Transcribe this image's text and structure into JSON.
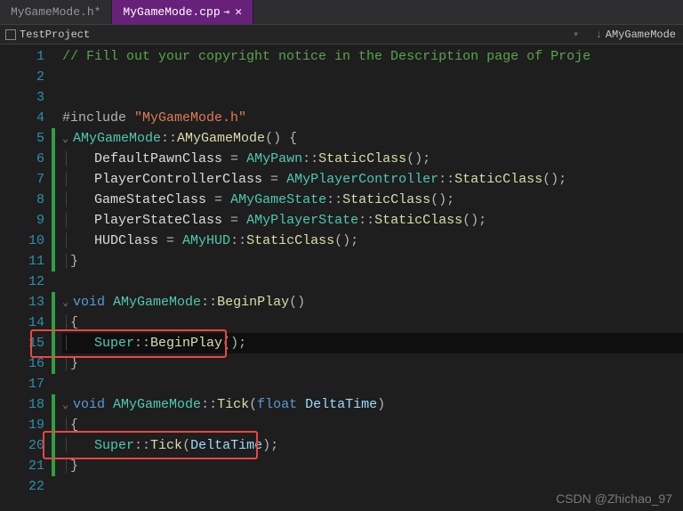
{
  "tabs": {
    "inactive_label": "MyGameMode.h*",
    "active_label": "MyGameMode.cpp",
    "pin_glyph": "⊸",
    "close_glyph": "✕"
  },
  "breadcrumb": {
    "project": "TestProject",
    "scope": "AMyGameMode",
    "arrow_down": "↓"
  },
  "lines": {
    "l1": "// Fill out your copyright notice in the Description page of Proje",
    "include_kw": "#include",
    "include_str": "\"MyGameMode.h\"",
    "class_a": "AMyGameMode",
    "dbl_colon": "::",
    "ctor_open": "() {",
    "defpawn": "DefaultPawnClass",
    "eq": " = ",
    "amypawn": "AMyPawn",
    "staticclass": "StaticClass",
    "callend": "();",
    "playerctrl": "PlayerControllerClass",
    "amypc": "AMyPlayerController",
    "gamestate": "GameStateClass",
    "amygs": "AMyGameState",
    "playerstate": "PlayerStateClass",
    "amyps": "AMyPlayerState",
    "hudclass": "HUDClass",
    "amyhud": "AMyHUD",
    "void": "void",
    "space": " ",
    "beginplay": "BeginPlay",
    "noarg": "()",
    "open_brace": "{",
    "close_brace": "}",
    "super": "Super",
    "tick": "Tick",
    "float": "float",
    "deltatime": "DeltaTime",
    "lparen": "(",
    "rparen_semi": ");",
    "rparen": ")"
  },
  "watermark": "CSDN @Zhichao_97"
}
